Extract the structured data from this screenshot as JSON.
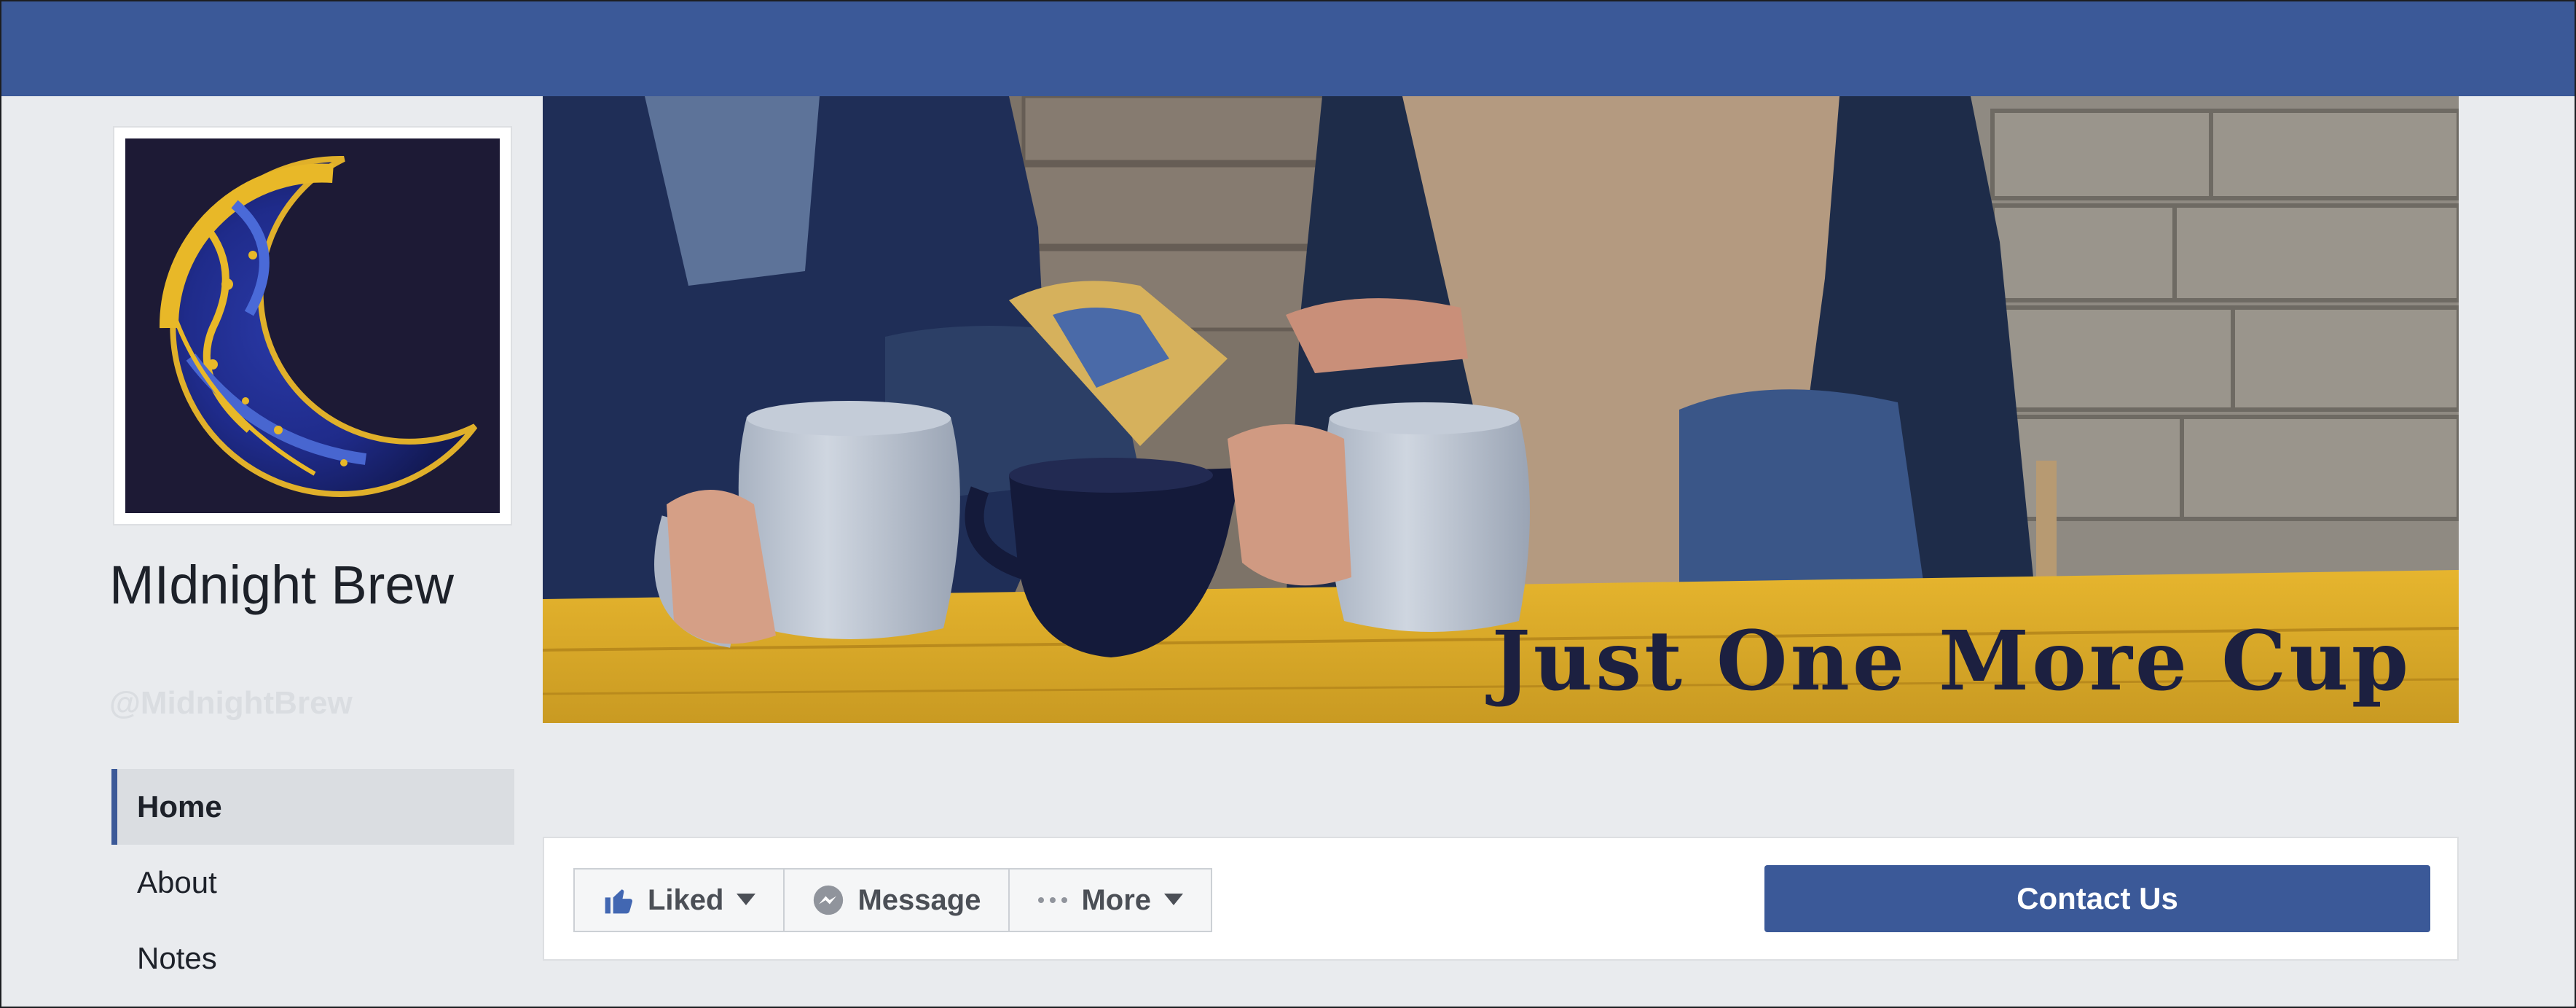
{
  "header": {
    "color": "#3b5998"
  },
  "profile": {
    "name": "MIdnight Brew",
    "handle": "@MidnightBrew",
    "avatar_icon": "crescent-moon-logo"
  },
  "nav": {
    "items": [
      {
        "label": "Home",
        "active": true
      },
      {
        "label": "About",
        "active": false
      },
      {
        "label": "Notes",
        "active": false
      }
    ]
  },
  "cover": {
    "tagline": "Just One More Cup",
    "description_icon": "two-people-with-coffee-mugs-photo"
  },
  "actions": {
    "liked_label": "Liked",
    "message_label": "Message",
    "more_label": "More",
    "contact_label": "Contact Us"
  },
  "colors": {
    "accent": "#3b5998",
    "background": "#e9ebee"
  }
}
